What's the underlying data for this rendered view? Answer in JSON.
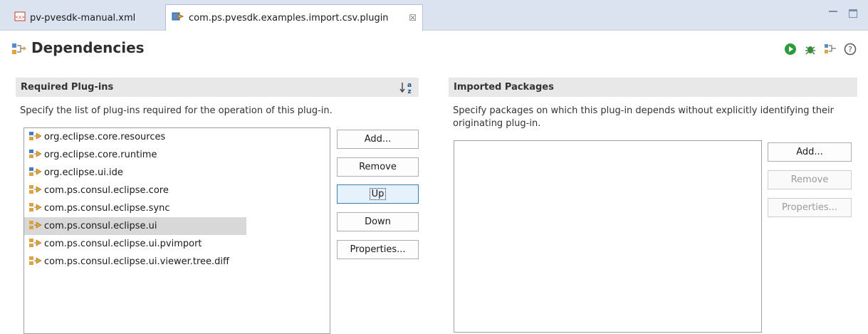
{
  "tabs": [
    {
      "label": "pv-pvesdk-manual.xml"
    },
    {
      "label": "com.ps.pvesdk.examples.import.csv.plugin",
      "close": "☒"
    }
  ],
  "page": {
    "title": "Dependencies"
  },
  "required": {
    "header": "Required Plug-ins",
    "description": "Specify the list of plug-ins required for the operation of this plug-in.",
    "items": [
      {
        "label": "org.eclipse.core.resources"
      },
      {
        "label": "org.eclipse.core.runtime"
      },
      {
        "label": "org.eclipse.ui.ide"
      },
      {
        "label": "com.ps.consul.eclipse.core"
      },
      {
        "label": "com.ps.consul.eclipse.sync"
      },
      {
        "label": "com.ps.consul.eclipse.ui"
      },
      {
        "label": "com.ps.consul.eclipse.ui.pvimport"
      },
      {
        "label": "com.ps.consul.eclipse.ui.viewer.tree.diff"
      }
    ],
    "selected_index": 5,
    "buttons": {
      "add": "Add...",
      "remove": "Remove",
      "up": "Up",
      "down": "Down",
      "properties": "Properties..."
    }
  },
  "imported": {
    "header": "Imported Packages",
    "description_line1": "Specify packages on which this plug-in depends without explicitly identifying their",
    "description_line2": "originating plug-in.",
    "buttons": {
      "add": "Add...",
      "remove": "Remove",
      "properties": "Properties..."
    }
  },
  "colors": {
    "tabbar": "#dae3ef",
    "section_header": "#e8e8e8",
    "run_green": "#2e9a3e",
    "selection": "#d8d8d8"
  }
}
